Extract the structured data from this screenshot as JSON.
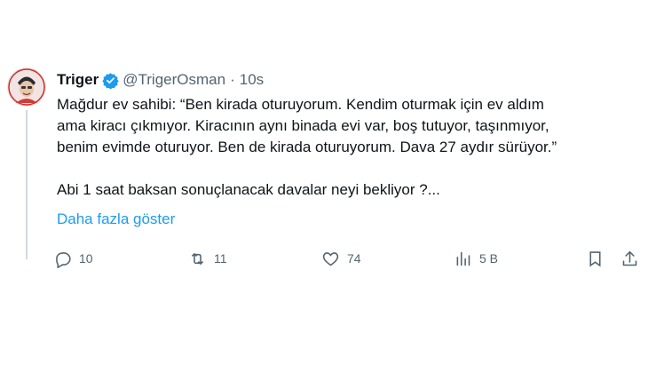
{
  "author": {
    "name": "Triger",
    "handle": "@TrigerOsman",
    "separator": "·",
    "time": "10s"
  },
  "tweet": {
    "line1": "Mağdur ev sahibi:  “Ben kirada oturuyorum. Kendim oturmak için ev aldım",
    "line2": "ama kiracı çıkmıyor. Kiracının aynı binada evi var, boş tutuyor, taşınmıyor,",
    "line3": "benim evimde oturuyor. Ben de kirada oturuyorum. Dava 27 aydır sürüyor.”",
    "line4": "Abi 1 saat baksan sonuçlanacak davalar neyi bekliyor ?...",
    "show_more": "Daha fazla göster"
  },
  "actions": {
    "reply_count": "10",
    "retweet_count": "11",
    "like_count": "74",
    "views_count": "5 B"
  },
  "colors": {
    "link": "#1d9bf0",
    "muted": "#536471",
    "verified": "#1d9bf0"
  },
  "icons": [
    "avatar-image",
    "verified-badge-icon",
    "reply-icon",
    "retweet-icon",
    "like-icon",
    "views-icon",
    "bookmark-icon",
    "share-icon"
  ]
}
